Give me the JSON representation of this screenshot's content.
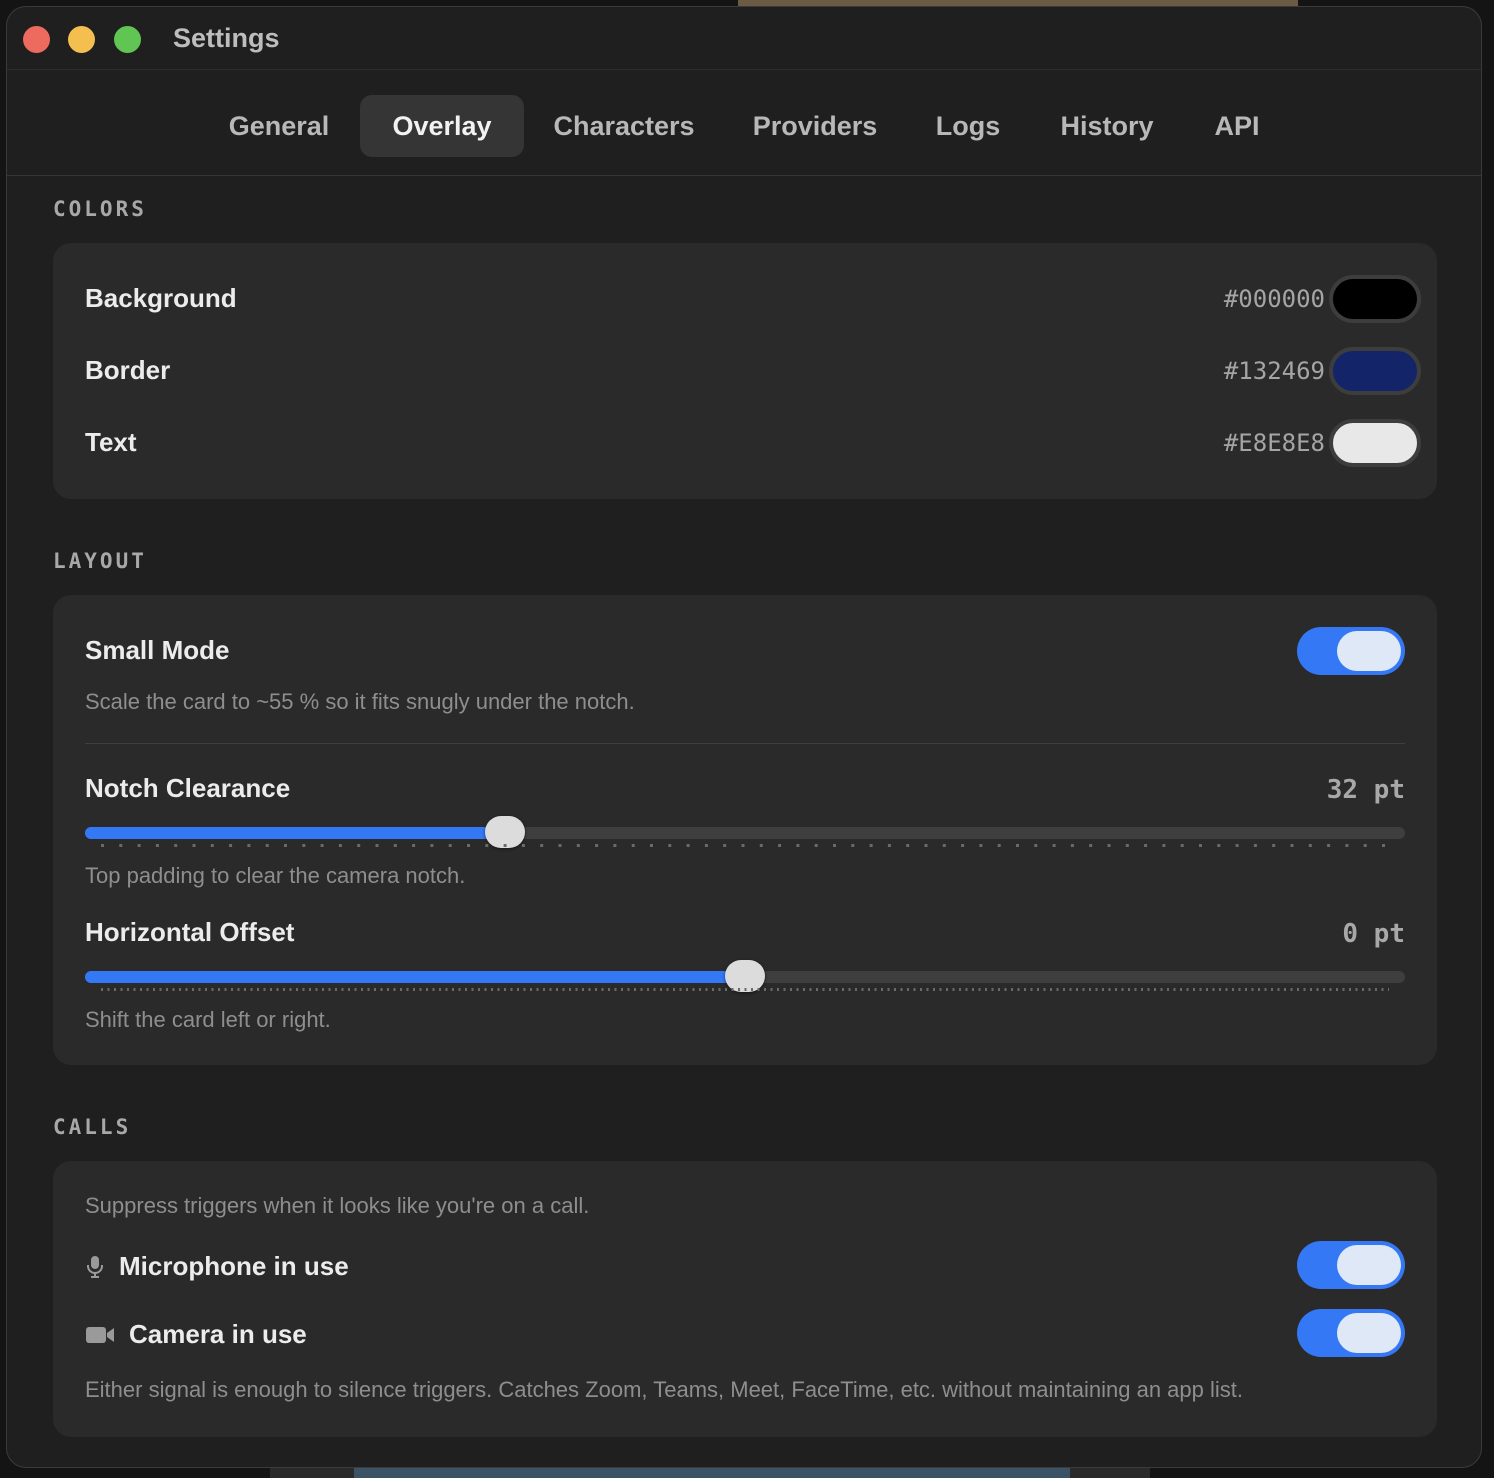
{
  "window": {
    "title": "Settings"
  },
  "tabs": [
    {
      "label": "General"
    },
    {
      "label": "Overlay",
      "active": true
    },
    {
      "label": "Characters"
    },
    {
      "label": "Providers"
    },
    {
      "label": "Logs"
    },
    {
      "label": "History"
    },
    {
      "label": "API"
    }
  ],
  "colors": {
    "section_title": "COLORS",
    "rows": [
      {
        "label": "Background",
        "hex": "#000000",
        "swatch": "#000000"
      },
      {
        "label": "Border",
        "hex": "#132469",
        "swatch": "#132469"
      },
      {
        "label": "Text",
        "hex": "#E8E8E8",
        "swatch": "#E8E8E8"
      }
    ]
  },
  "layout": {
    "section_title": "LAYOUT",
    "small_mode": {
      "label": "Small Mode",
      "description": "Scale the card to ~55 % so it fits snugly under the notch.",
      "enabled": true
    },
    "notch_clearance": {
      "label": "Notch Clearance",
      "value_text": "32 pt",
      "fraction": 0.318,
      "description": "Top padding to clear the camera notch."
    },
    "horizontal_offset": {
      "label": "Horizontal Offset",
      "value_text": "0 pt",
      "fraction": 0.5,
      "description": "Shift the card left or right."
    }
  },
  "calls": {
    "section_title": "CALLS",
    "intro": "Suppress triggers when it looks like you're on a call.",
    "microphone": {
      "label": "Microphone in use",
      "icon": "microphone-icon",
      "enabled": true
    },
    "camera": {
      "label": "Camera in use",
      "icon": "video-camera-icon",
      "enabled": true
    },
    "footnote": "Either signal is enough to silence triggers. Catches Zoom, Teams, Meet, FaceTime, etc. without maintaining an app list."
  },
  "accent_color": "#3478F6"
}
